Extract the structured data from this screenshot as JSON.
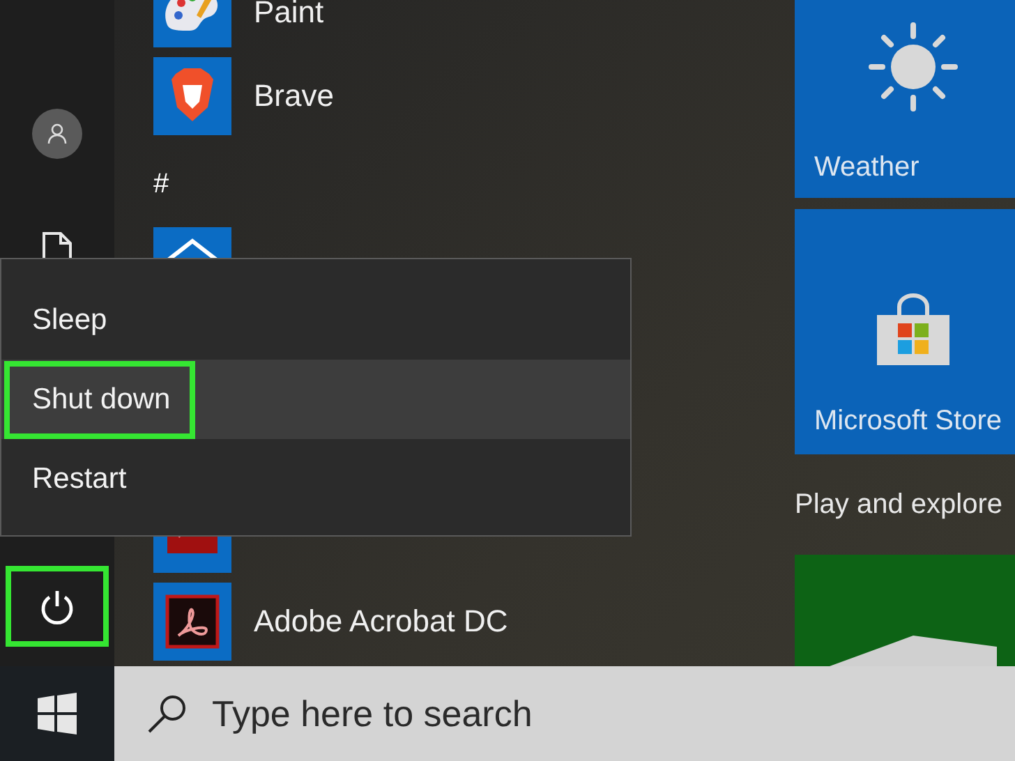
{
  "rail": {
    "power_button": {
      "highlighted": true
    }
  },
  "app_list": [
    {
      "kind": "app",
      "label": "Paint"
    },
    {
      "kind": "app",
      "label": "Brave"
    },
    {
      "kind": "heading",
      "label": "#"
    },
    {
      "kind": "app"
    },
    {
      "kind": "app"
    },
    {
      "kind": "app",
      "label": "Adobe Acrobat DC"
    }
  ],
  "tiles": [
    {
      "kind": "tile",
      "label": "Weather"
    },
    {
      "kind": "tile",
      "label": "Microsoft Store"
    },
    {
      "kind": "heading",
      "label": "Play and explore"
    },
    {
      "kind": "tile"
    }
  ],
  "power_menu": [
    {
      "label": "Sleep",
      "selected": false,
      "highlighted": false
    },
    {
      "label": "Shut down",
      "selected": true,
      "highlighted": true
    },
    {
      "label": "Restart",
      "selected": false,
      "highlighted": false
    }
  ],
  "taskbar": {
    "search": {
      "placeholder": "Type here to search"
    }
  }
}
